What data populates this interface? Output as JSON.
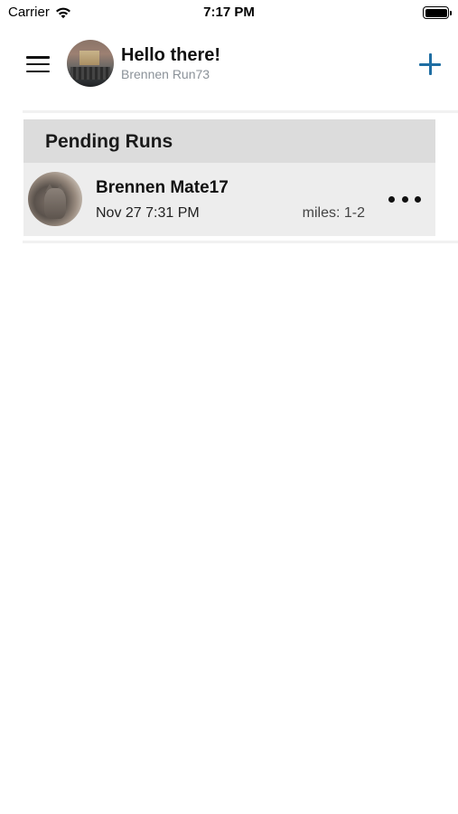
{
  "status_bar": {
    "carrier": "Carrier",
    "time": "7:17 PM"
  },
  "header": {
    "greeting": "Hello there!",
    "username": "Brennen Run73",
    "icons": {
      "menu": "menu-icon",
      "add": "plus-icon"
    }
  },
  "pending": {
    "title": "Pending Runs",
    "runs": [
      {
        "name": "Brennen Mate17",
        "date": "Nov 27 7:31 PM",
        "miles": "miles: 1-2"
      }
    ]
  },
  "colors": {
    "accent": "#1f6ea3",
    "section_header_bg": "#dcdcdc",
    "row_bg": "#ededed",
    "secondary_text": "#8b9299"
  }
}
